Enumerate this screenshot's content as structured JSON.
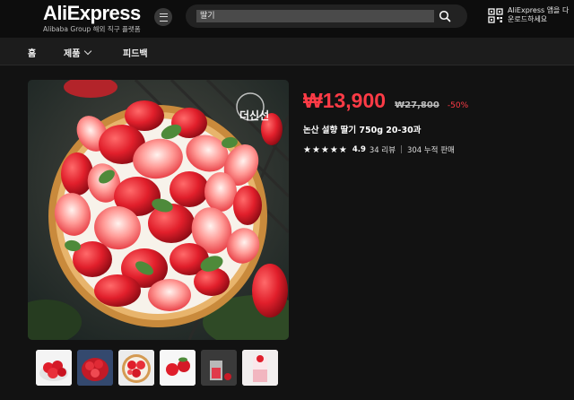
{
  "header": {
    "logo": "AliExpress",
    "tagline": "Alibaba Group 해외 직구 플랫폼",
    "search_placeholder": "딸기",
    "app_download_line1": "AliExpress 앱을 다",
    "app_download_line2": "운로드하세요"
  },
  "nav": {
    "items": [
      {
        "label": "홈"
      },
      {
        "label": "제품"
      },
      {
        "label": "피드백"
      }
    ]
  },
  "product": {
    "price": "₩13,900",
    "original_price": "₩27,800",
    "discount": "-50%",
    "title": "논산 설향 딸기 750g 20-30과",
    "rating": "4.9",
    "reviews": "34 리뷰",
    "sold": "304 누적 판매",
    "watermark": "더신선",
    "star_count": 5
  },
  "thumbnails": [
    "thumb-1",
    "thumb-2",
    "thumb-3",
    "thumb-4",
    "thumb-5",
    "thumb-6"
  ],
  "colors": {
    "accent": "#ff3b46",
    "background": "#121212"
  }
}
